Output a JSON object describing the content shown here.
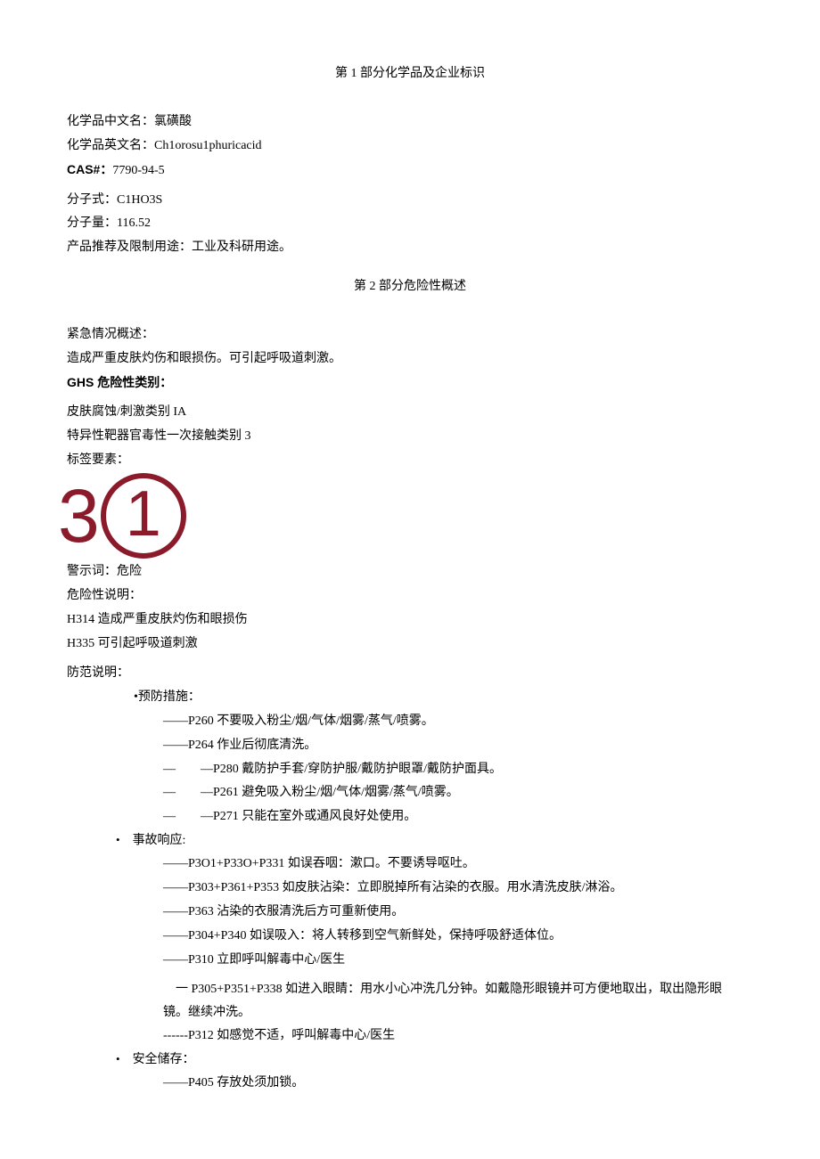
{
  "section1": {
    "title": "第 1 部分化学品及企业标识",
    "rows": [
      {
        "label": "化学品中文名：",
        "value": "氯磺酸"
      },
      {
        "label": "化学品英文名：",
        "value": "Ch1orosu1phuricacid"
      },
      {
        "label": "CAS#：",
        "value": "7790-94-5",
        "label_bold": true
      },
      {
        "label": "分子式：",
        "value": "C1HO3S"
      },
      {
        "label": "分子量：",
        "value": "116.52"
      },
      {
        "label": "产品推荐及限制用途：",
        "value": "工业及科研用途。"
      }
    ]
  },
  "section2": {
    "title": "第 2 部分危险性概述",
    "emergency_label": "紧急情况概述：",
    "emergency_text": "造成严重皮肤灼伤和眼损伤。可引起呼吸道刺激。",
    "ghs_label": "GHS 危险性类别：",
    "ghs_cats": [
      "皮肤腐蚀/刺激类别 IA",
      "特异性靶器官毒性一次接触类别 3"
    ],
    "label_elements": "标签要素：",
    "picto_3": "3",
    "picto_1": "1",
    "signal_label": "警示词：",
    "signal_word": "危险",
    "hazard_label": "危险性说明：",
    "hazards": [
      "H314 造成严重皮肤灼伤和眼损伤",
      "H335 可引起呼吸道刺激"
    ],
    "precaution_label": "防范说明：",
    "prevention_head": "•预防措施：",
    "prevention_items": [
      "——P260 不要吸入粉尘/烟/气体/烟雾/蒸气/喷雾。",
      "——P264 作业后彻底清洗。",
      "—　　—P280 戴防护手套/穿防护服/戴防护眼罩/戴防护面具。",
      "—　　—P261 避免吸入粉尘/烟/气体/烟雾/蒸气/喷雾。",
      "—　　—P271 只能在室外或通风良好处使用。"
    ],
    "response_head": "事故响应:",
    "response_items": [
      "——P3O1+P33O+P331 如误吞咽：漱口。不要诱导呕吐。",
      "——P303+P361+P353 如皮肤沾染：立即脱掉所有沾染的衣服。用水清洗皮肤/淋浴。",
      "——P363 沾染的衣服清洗后方可重新使用。",
      "——P304+P340 如误吸入：将人转移到空气新鲜处，保持呼吸舒适体位。",
      "——P310 立即呼叫解毒中心/医生"
    ],
    "response_extra1": "一 P305+P351+P338 如进入眼睛：用水小心冲洗几分钟。如戴隐形眼镜并可方便地取出，取出隐形眼镜。继续冲洗。",
    "response_extra2": "------P312 如感觉不适，呼叫解毒中心/医生",
    "storage_head": "安全储存：",
    "storage_items": [
      "——P405 存放处须加锁。"
    ]
  }
}
